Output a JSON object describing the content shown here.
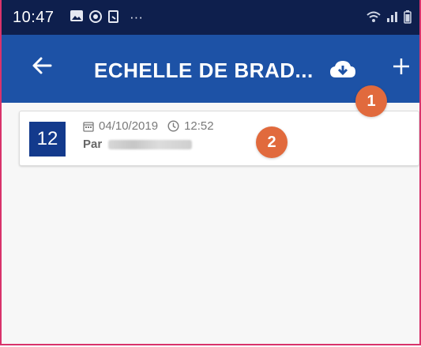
{
  "status_bar": {
    "time": "10:47",
    "overflow": "···"
  },
  "appbar": {
    "title": "ECHELLE DE BRAD...",
    "back_icon": "arrow-left-icon",
    "download_icon": "cloud-download-icon",
    "add_icon": "plus-icon"
  },
  "records": [
    {
      "number": "12",
      "date": "04/10/2019",
      "time": "12:52",
      "author_prefix": "Par"
    }
  ],
  "markers": [
    "1",
    "2"
  ],
  "colors": {
    "appbar": "#1d52a6",
    "statusbar": "#0e1f4d",
    "number_box": "#133a8c",
    "marker": "#e16a3d",
    "frame_border": "#d9336b"
  }
}
